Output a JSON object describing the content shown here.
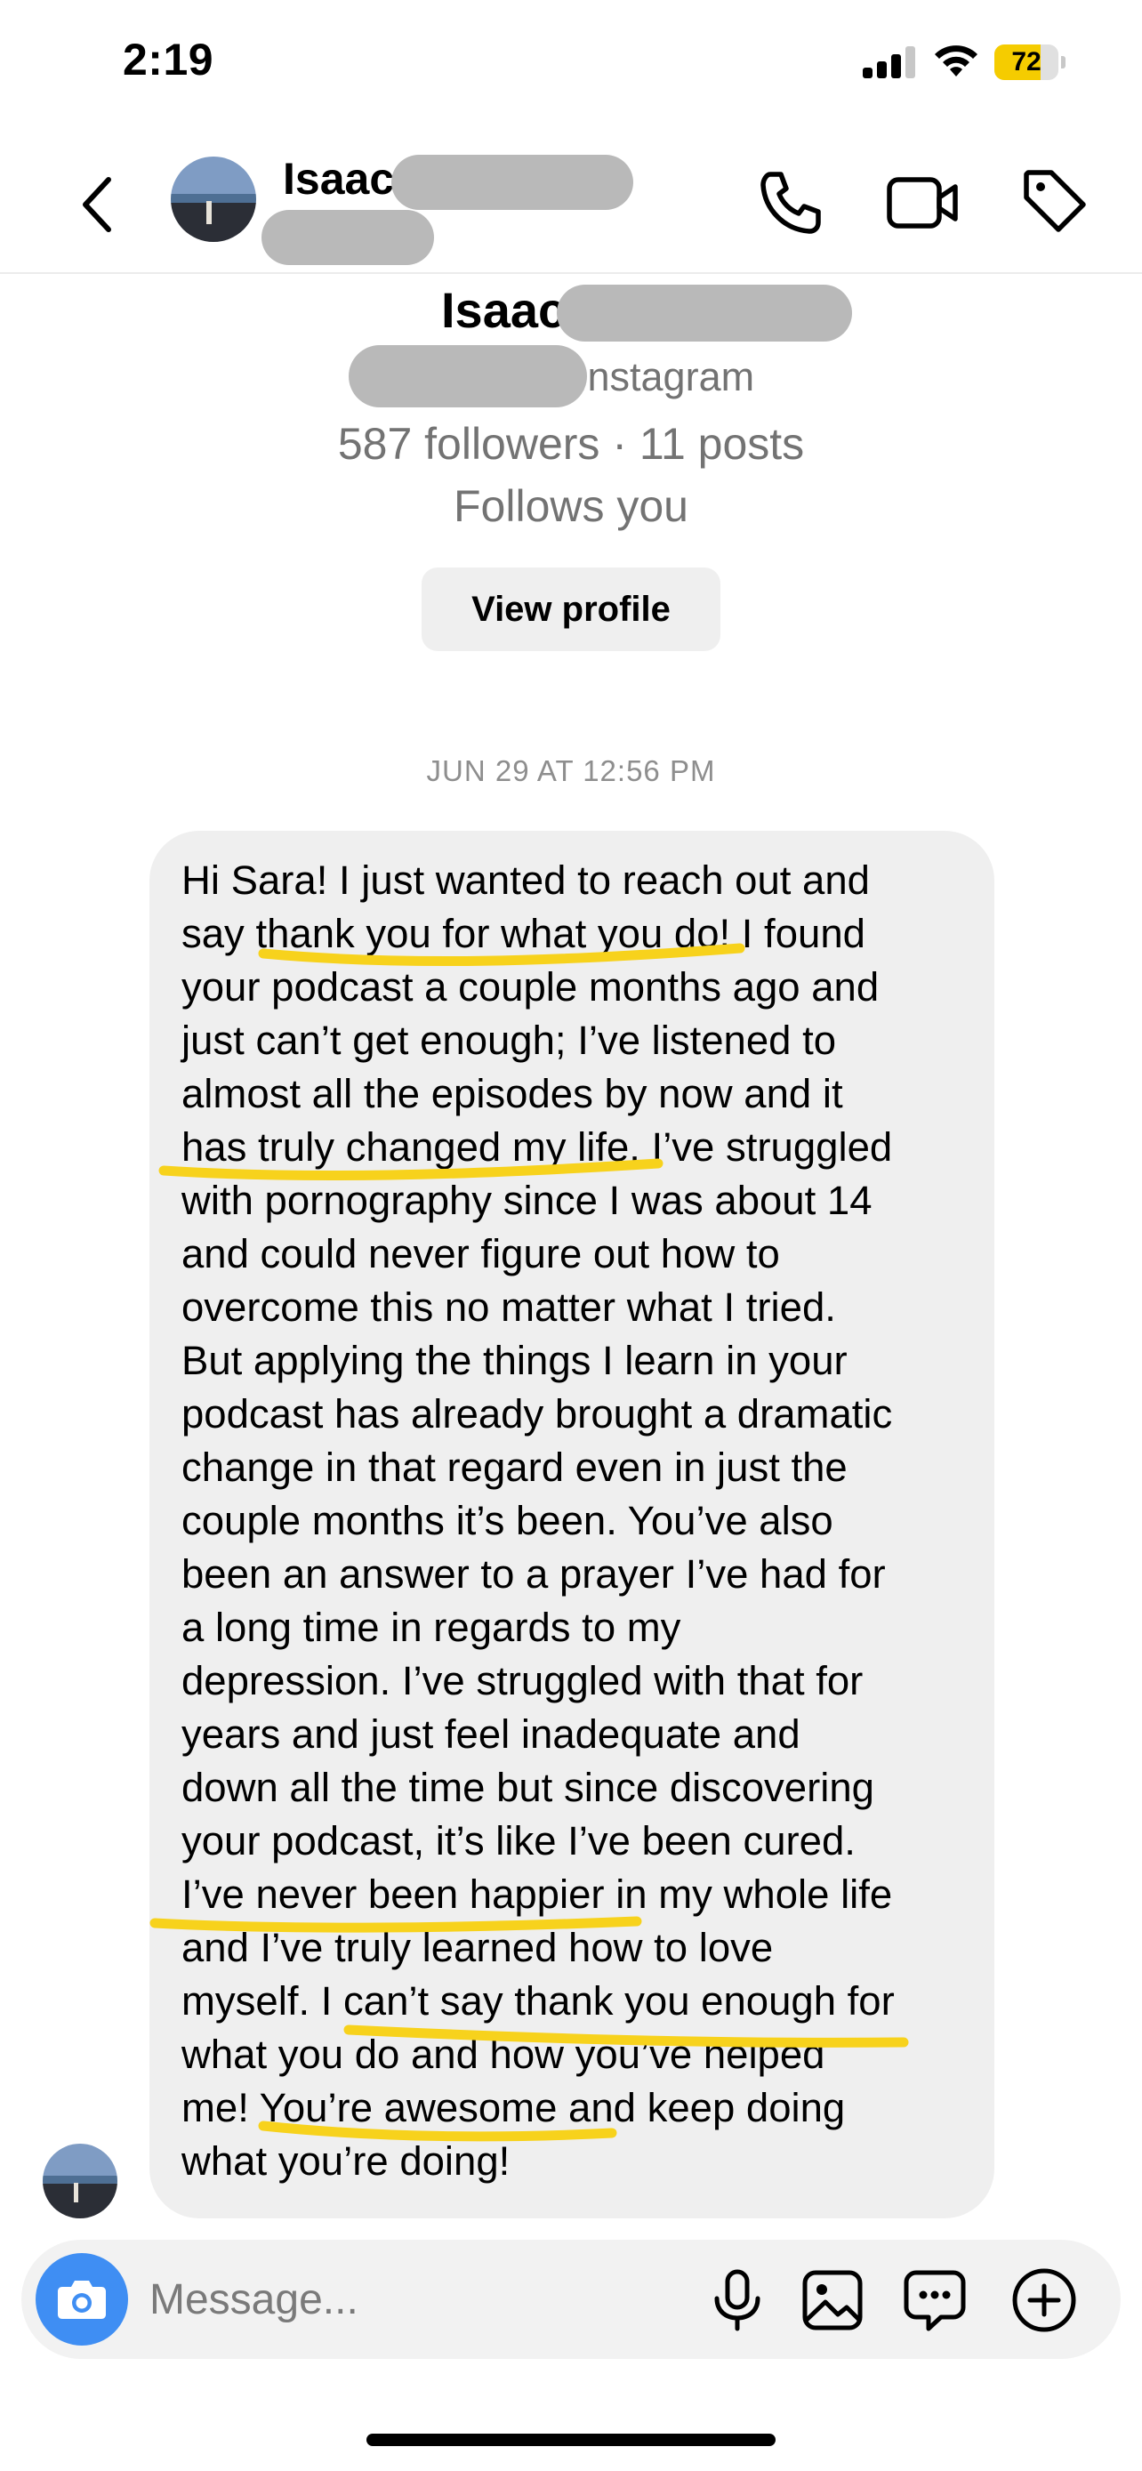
{
  "status_bar": {
    "time": "2:19",
    "battery_level": "72",
    "battery_fraction": 0.72,
    "battery_color": "#f5cc00"
  },
  "header": {
    "contact_name": "Isaac",
    "icons": [
      "back-chevron-icon",
      "phone-icon",
      "video-camera-icon",
      "tag-icon"
    ]
  },
  "profile": {
    "name": "Isaac",
    "platform": "Instagram",
    "stats": "587 followers · 11 posts",
    "follow_status": "Follows you",
    "view_profile_label": "View profile"
  },
  "conversation": {
    "timestamp": "JUN 29 AT 12:56 PM",
    "message": "Hi Sara! I just wanted to reach out and\nsay thank you for what you do! I found\nyour podcast a couple months ago and\njust can’t get enough; I’ve listened to\nalmost all the episodes by now and it\nhas truly changed my life. I’ve struggled\nwith pornography since I was about 14\nand could never figure out how to\novercome this no matter what I tried.\nBut applying the things I learn in your\npodcast has already brought a dramatic\nchange in that regard even in just the\ncouple months it’s been. You’ve also\nbeen an answer to a prayer I’ve had for\na long time in regards to my\ndepression. I’ve struggled with that for\nyears and just feel inadequate and\ndown all the time but since discovering\nyour podcast, it’s like I’ve been cured.\nI’ve never been happier in my whole life\nand I’ve truly learned how to love\nmyself. I can’t say thank you enough for\nwhat you do and how you’ve helped\nme! You’re awesome and keep doing\nwhat you’re doing!",
    "highlight_color": "#f7d21c"
  },
  "composer": {
    "placeholder": "Message...",
    "camera_color": "#3f8ef3",
    "icons": [
      "camera-icon",
      "microphone-icon",
      "gallery-icon",
      "sticker-icon",
      "plus-icon"
    ]
  }
}
